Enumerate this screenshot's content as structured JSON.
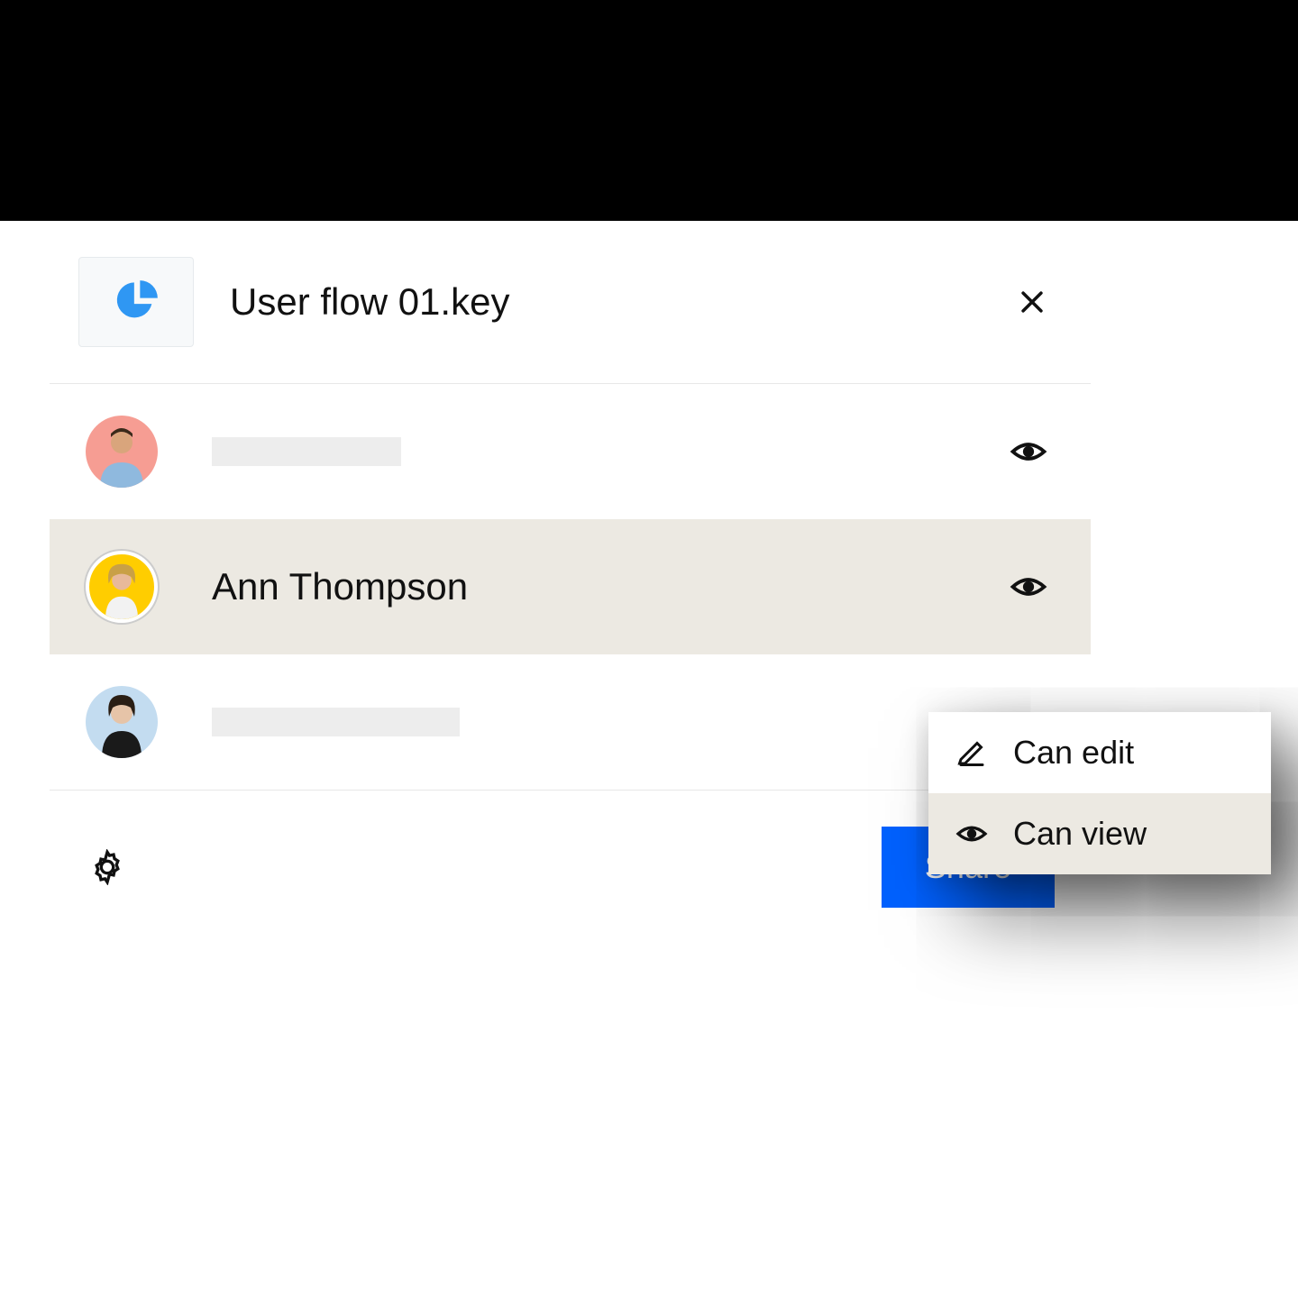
{
  "header": {
    "filename": "User flow 01.key"
  },
  "people": [
    {
      "name": "",
      "permission_icon": "eye",
      "highlighted": false,
      "avatar_color": "#f69d93"
    },
    {
      "name": "Ann Thompson",
      "permission_icon": "eye",
      "highlighted": true,
      "avatar_color": "#ffcd00"
    },
    {
      "name": "",
      "permission_icon": "eye",
      "highlighted": false,
      "avatar_color": "#c3dcf0"
    }
  ],
  "dropdown": {
    "items": [
      {
        "icon": "pencil",
        "label": "Can edit",
        "selected": false
      },
      {
        "icon": "eye",
        "label": "Can view",
        "selected": true
      }
    ]
  },
  "footer": {
    "share_label": "Share"
  },
  "colors": {
    "accent": "#0061fe",
    "highlight": "#ece9e2"
  }
}
